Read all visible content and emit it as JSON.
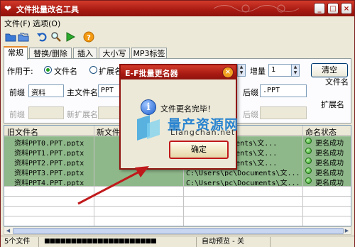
{
  "window": {
    "title": "文件批量改名工具"
  },
  "menu": {
    "file": "文件(F)",
    "options": "选项(O)"
  },
  "tabs": [
    "常规",
    "替换/删除",
    "插入",
    "大小写",
    "MP3标签"
  ],
  "general": {
    "apply_to_label": "作用于:",
    "radio_filename": "文件名",
    "radio_ext": "扩展名",
    "increment_label": "增量",
    "increment_value": "1",
    "clear_label": "清空",
    "filename_section": "文件名",
    "prefix_label": "前缀",
    "prefix_value": "资料",
    "main_name_label": "主文件名",
    "main_name_value": "PPT",
    "suffix_label": "后缀",
    "suffix_value": ".PPT",
    "ext_section": "扩展名",
    "ext_prefix_label": "前缀",
    "new_ext_label": "新扩展名",
    "ext_suffix_label": "后缀"
  },
  "grid": {
    "columns": [
      "旧文件名",
      "新文件",
      "",
      "命名状态"
    ],
    "rows": [
      {
        "old": "资料PPT0.PPT.pptx",
        "path": "Documents\\文...",
        "status": "更名成功"
      },
      {
        "old": "资料PPT1.PPT.pptx",
        "path": "Documents\\文...",
        "status": "更名成功"
      },
      {
        "old": "资料PPT2.PPT.pptx",
        "path": "Documents\\文...",
        "status": "更名成功"
      },
      {
        "old": "资料PPT3.PPT.pptx",
        "path": "C:\\Users\\pc\\Documents\\文...",
        "status": "更名成功"
      },
      {
        "old": "资料PPT4.PPT.pptx",
        "path": "C:\\Users\\pc\\Documents\\文...",
        "status": "更名成功"
      }
    ]
  },
  "statusbar": {
    "count": "5个文件",
    "progress": "■■■■■■■■■■■■■■■■■■■■■",
    "preview": "自动预览 - 关"
  },
  "dialog": {
    "title": "E-F批量更名器",
    "message": "文件更名完毕！",
    "ok": "确定"
  },
  "watermark": {
    "name": "量产资源网",
    "url": "Liangchan.net"
  },
  "colors": {
    "title_red": "#a81a12",
    "row_green": "#8fb88a",
    "annotation": "#c0191b"
  }
}
